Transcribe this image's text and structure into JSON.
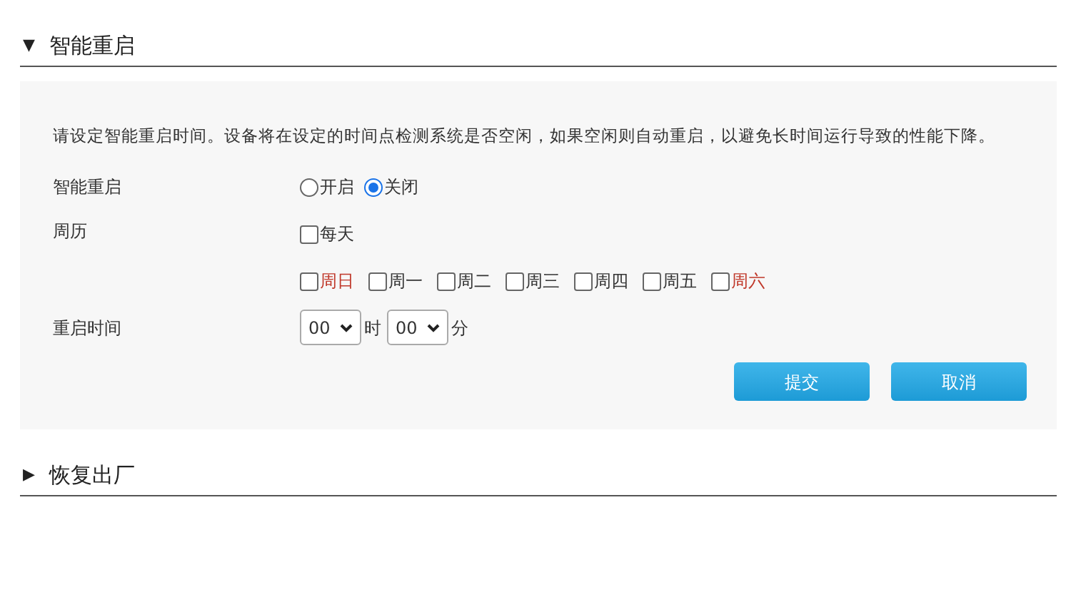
{
  "sections": [
    {
      "marker": "▼",
      "title": "智能重启",
      "expanded": true,
      "description": "请设定智能重启时间。设备将在设定的时间点检测系统是否空闲，如果空闲则自动重启，以避免长时间运行导致的性能下降。",
      "mode": {
        "label": "智能重启",
        "options": [
          {
            "label": "开启",
            "selected": false
          },
          {
            "label": "关闭",
            "selected": true
          }
        ]
      },
      "calendar": {
        "label": "周历",
        "everyday": {
          "label": "每天",
          "checked": false
        },
        "days": [
          {
            "label": "周日",
            "checked": false,
            "color": "#c0392b"
          },
          {
            "label": "周一",
            "checked": false,
            "color": "#333333"
          },
          {
            "label": "周二",
            "checked": false,
            "color": "#333333"
          },
          {
            "label": "周三",
            "checked": false,
            "color": "#333333"
          },
          {
            "label": "周四",
            "checked": false,
            "color": "#333333"
          },
          {
            "label": "周五",
            "checked": false,
            "color": "#333333"
          },
          {
            "label": "周六",
            "checked": false,
            "color": "#c0392b"
          }
        ]
      },
      "time": {
        "label": "重启时间",
        "hour": "00",
        "hour_unit": "时",
        "minute": "00",
        "minute_unit": "分"
      },
      "buttons": [
        "提交",
        "取消"
      ]
    },
    {
      "marker": "▶",
      "title": "恢复出厂",
      "expanded": false
    }
  ]
}
